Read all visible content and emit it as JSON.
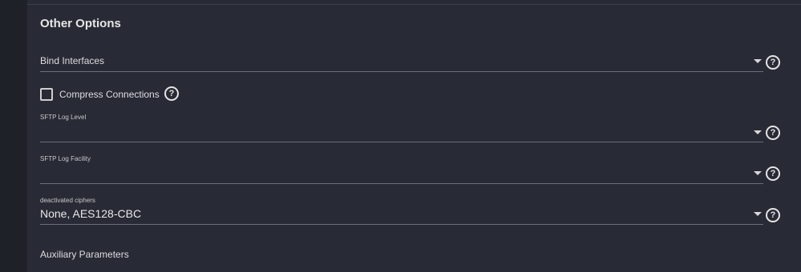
{
  "section": {
    "title": "Other Options"
  },
  "fields": {
    "bind_interfaces": {
      "label": "Bind Interfaces",
      "value": ""
    },
    "compress_connections": {
      "label": "Compress Connections",
      "checked": false
    },
    "sftp_log_level": {
      "label": "SFTP Log Level",
      "value": ""
    },
    "sftp_log_facility": {
      "label": "SFTP Log Facility",
      "value": ""
    },
    "deactivated_ciphers": {
      "label": "deactivated ciphers",
      "value": "None, AES128-CBC"
    }
  },
  "auxiliary": {
    "title": "Auxiliary Parameters"
  },
  "icons": {
    "dropdown": "chevron-down-icon",
    "help": "help-circle-icon",
    "help_glyph": "?"
  },
  "colors": {
    "panel_bg": "#282a35",
    "page_bg": "#1e1f26",
    "text": "#e6e6e6",
    "underline": "#6b6e7c"
  }
}
